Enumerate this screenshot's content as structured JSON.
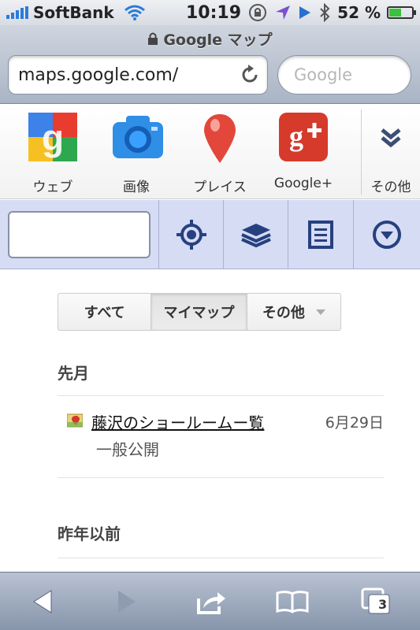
{
  "status": {
    "carrier": "SoftBank",
    "time": "10:19",
    "battery_percent": "52 %",
    "battery_level": 0.52
  },
  "browser": {
    "page_title": "Google マップ",
    "url": "maps.google.com/",
    "search_placeholder": "Google",
    "tab_count": "3"
  },
  "apps": [
    {
      "label": "ウェブ",
      "icon": "google-web-icon"
    },
    {
      "label": "画像",
      "icon": "camera-icon"
    },
    {
      "label": "プレイス",
      "icon": "places-pin-icon"
    },
    {
      "label": "Google+",
      "icon": "google-plus-icon"
    },
    {
      "label": "その他",
      "icon": "more-chevron-icon"
    }
  ],
  "maps_toolbar": {
    "search_value": "",
    "buttons": [
      "locate-icon",
      "layers-icon",
      "list-icon",
      "dropdown-circle-icon"
    ]
  },
  "filters": {
    "all": "すべて",
    "my_maps": "マイマップ",
    "other": "その他",
    "selected": "マイマップ"
  },
  "sections": {
    "last_month": "先月",
    "before_last_year": "昨年以前"
  },
  "items": [
    {
      "title": "藤沢のショールームー覧",
      "visibility": "一般公開",
      "date": "6月29日"
    }
  ],
  "colors": {
    "maps_toolbar_bg": "#d5dcf4",
    "icon_blue": "#27407f"
  }
}
